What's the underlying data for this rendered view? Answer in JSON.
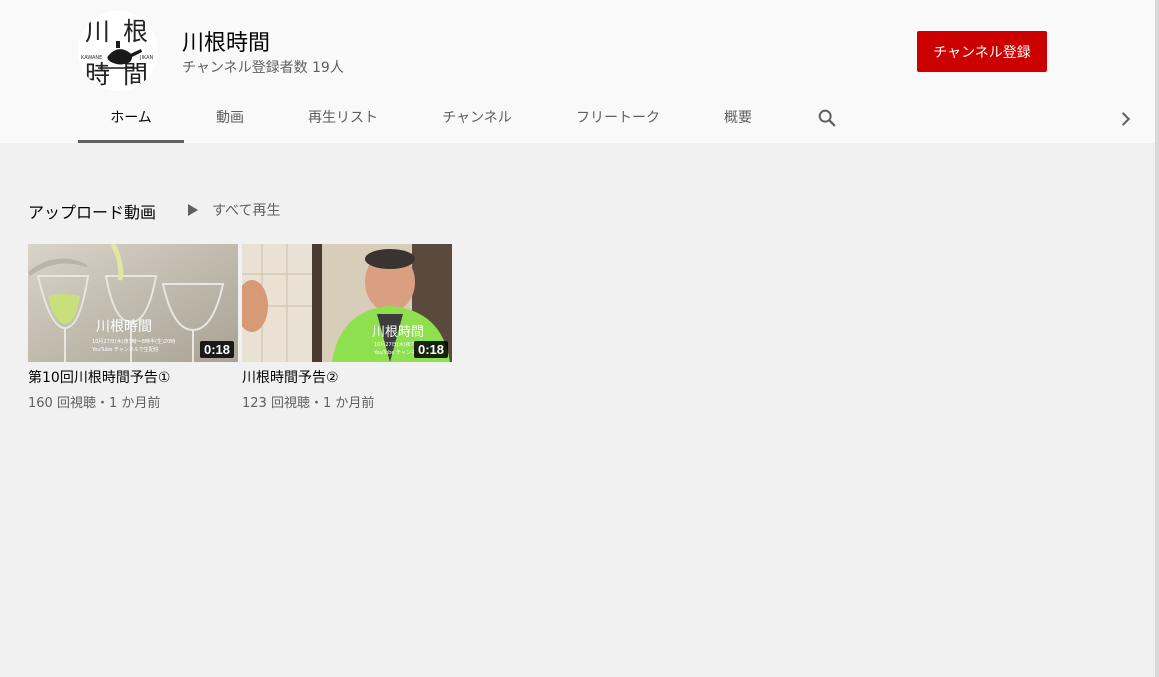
{
  "channel": {
    "name": "川根時間",
    "subscribers": "チャンネル登録者数 19人",
    "subscribe_label": "チャンネル登録",
    "logo": {
      "kanji": [
        "川",
        "根",
        "時",
        "間"
      ],
      "romaji_left": "KAWANE",
      "romaji_right": "JIKAN"
    }
  },
  "tabs": [
    {
      "label": "ホーム",
      "active": true
    },
    {
      "label": "動画"
    },
    {
      "label": "再生リスト"
    },
    {
      "label": "チャンネル"
    },
    {
      "label": "フリートーク"
    },
    {
      "label": "概要"
    }
  ],
  "icons": {
    "search": "search-icon",
    "next": "chevron-right-icon",
    "play": "play-icon"
  },
  "shelf": {
    "title": "アップロード動画",
    "play_all": "すべて再生"
  },
  "videos": [
    {
      "title": "第10回川根時間予告①",
      "meta": "160 回視聴・1 か月前",
      "duration": "0:18",
      "overlay_title": "川根時間",
      "overlay_line1": "10月27日(木)夜7時〜8時半(生)20時",
      "overlay_line2": "YouTube チャンネルで生配信"
    },
    {
      "title": "川根時間予告②",
      "meta": "123 回視聴・1 か月前",
      "duration": "0:18",
      "overlay_title": "川根時間",
      "overlay_line1": "10月27日(木)夜7時〜",
      "overlay_line2": "YouTube チャンネ"
    }
  ],
  "colors": {
    "subscribe": "#cc0000",
    "header_bg": "#f9f9f9",
    "page_bg": "#f1f1f1",
    "happi_green": "#8fe04f"
  }
}
